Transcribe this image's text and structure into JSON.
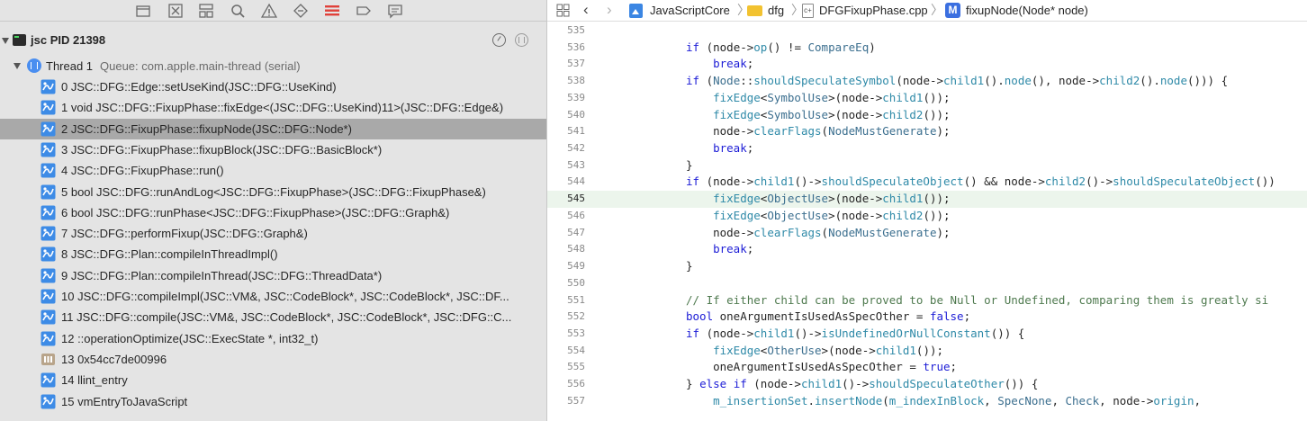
{
  "navigator": {
    "process": {
      "name": "jsc",
      "pid": "PID 21398"
    },
    "thread": {
      "name": "Thread 1",
      "queue": "Queue: com.apple.main-thread (serial)"
    },
    "frames": [
      {
        "label": "0 JSC::DFG::Edge::setUseKind(JSC::DFG::UseKind)",
        "icon": "user-frame-icon",
        "selected": false
      },
      {
        "label": "1 void JSC::DFG::FixupPhase::fixEdge<(JSC::DFG::UseKind)11>(JSC::DFG::Edge&)",
        "icon": "user-frame-icon",
        "selected": false
      },
      {
        "label": "2 JSC::DFG::FixupPhase::fixupNode(JSC::DFG::Node*)",
        "icon": "user-frame-icon",
        "selected": true
      },
      {
        "label": "3 JSC::DFG::FixupPhase::fixupBlock(JSC::DFG::BasicBlock*)",
        "icon": "user-frame-icon",
        "selected": false
      },
      {
        "label": "4 JSC::DFG::FixupPhase::run()",
        "icon": "user-frame-icon",
        "selected": false
      },
      {
        "label": "5 bool JSC::DFG::runAndLog<JSC::DFG::FixupPhase>(JSC::DFG::FixupPhase&)",
        "icon": "user-frame-icon",
        "selected": false
      },
      {
        "label": "6 bool JSC::DFG::runPhase<JSC::DFG::FixupPhase>(JSC::DFG::Graph&)",
        "icon": "user-frame-icon",
        "selected": false
      },
      {
        "label": "7 JSC::DFG::performFixup(JSC::DFG::Graph&)",
        "icon": "user-frame-icon",
        "selected": false
      },
      {
        "label": "8 JSC::DFG::Plan::compileInThreadImpl()",
        "icon": "user-frame-icon",
        "selected": false
      },
      {
        "label": "9 JSC::DFG::Plan::compileInThread(JSC::DFG::ThreadData*)",
        "icon": "user-frame-icon",
        "selected": false
      },
      {
        "label": "10 JSC::DFG::compileImpl(JSC::VM&, JSC::CodeBlock*, JSC::CodeBlock*, JSC::DF...",
        "icon": "user-frame-icon",
        "selected": false
      },
      {
        "label": "11 JSC::DFG::compile(JSC::VM&, JSC::CodeBlock*, JSC::CodeBlock*, JSC::DFG::C...",
        "icon": "user-frame-icon",
        "selected": false
      },
      {
        "label": "12 ::operationOptimize(JSC::ExecState *, int32_t)",
        "icon": "user-frame-icon",
        "selected": false
      },
      {
        "label": "13 0x54cc7de00996",
        "icon": "unknown-frame-icon",
        "selected": false
      },
      {
        "label": "14 llint_entry",
        "icon": "user-frame-icon",
        "selected": false
      },
      {
        "label": "15 vmEntryToJavaScript",
        "icon": "user-frame-icon",
        "selected": false
      }
    ]
  },
  "jumpbar": {
    "project": "JavaScriptCore",
    "folder": "dfg",
    "file": "DFGFixupPhase.cpp",
    "method_badge": "M",
    "symbol": "fixupNode(Node* node)"
  },
  "editor": {
    "current_line": "545",
    "lines": [
      {
        "n": "535",
        "html": ""
      },
      {
        "n": "536",
        "html": "<span class=\"kw\">if</span> (node-><span class=\"fn\">op</span>() != <span class=\"ty\">CompareEq</span>)"
      },
      {
        "n": "537",
        "html": "    <span class=\"kw\">break</span>;"
      },
      {
        "n": "538",
        "html": "<span class=\"kw\">if</span> (<span class=\"ty\">Node</span>::<span class=\"fn\">shouldSpeculateSymbol</span>(node-><span class=\"fn\">child1</span>().<span class=\"fn\">node</span>(), node-><span class=\"fn\">child2</span>().<span class=\"fn\">node</span>())) {"
      },
      {
        "n": "539",
        "html": "    <span class=\"fn\">fixEdge</span><<span class=\"ty\">SymbolUse</span>>(node-><span class=\"fn\">child1</span>());"
      },
      {
        "n": "540",
        "html": "    <span class=\"fn\">fixEdge</span><<span class=\"ty\">SymbolUse</span>>(node-><span class=\"fn\">child2</span>());"
      },
      {
        "n": "541",
        "html": "    node-><span class=\"fn\">clearFlags</span>(<span class=\"ty\">NodeMustGenerate</span>);"
      },
      {
        "n": "542",
        "html": "    <span class=\"kw\">break</span>;"
      },
      {
        "n": "543",
        "html": "}"
      },
      {
        "n": "544",
        "html": "<span class=\"kw\">if</span> (node-><span class=\"fn\">child1</span>()-><span class=\"fn\">shouldSpeculateObject</span>() && node-><span class=\"fn\">child2</span>()-><span class=\"fn\">shouldSpeculateObject</span>())"
      },
      {
        "n": "545",
        "html": "    <span class=\"fn\">fixEdge</span><<span class=\"ty\">ObjectUse</span>>(node-><span class=\"fn\">child1</span>());"
      },
      {
        "n": "546",
        "html": "    <span class=\"fn\">fixEdge</span><<span class=\"ty\">ObjectUse</span>>(node-><span class=\"fn\">child2</span>());"
      },
      {
        "n": "547",
        "html": "    node-><span class=\"fn\">clearFlags</span>(<span class=\"ty\">NodeMustGenerate</span>);"
      },
      {
        "n": "548",
        "html": "    <span class=\"kw\">break</span>;"
      },
      {
        "n": "549",
        "html": "}"
      },
      {
        "n": "550",
        "html": ""
      },
      {
        "n": "551",
        "html": "<span class=\"cm\">// If either child can be proved to be Null or Undefined, comparing them is greatly si</span>"
      },
      {
        "n": "552",
        "html": "<span class=\"kw\">bool</span> oneArgumentIsUsedAsSpecOther = <span class=\"bool\">false</span>;"
      },
      {
        "n": "553",
        "html": "<span class=\"kw\">if</span> (node-><span class=\"fn\">child1</span>()-><span class=\"fn\">isUndefinedOrNullConstant</span>()) {"
      },
      {
        "n": "554",
        "html": "    <span class=\"fn\">fixEdge</span><<span class=\"ty\">OtherUse</span>>(node-><span class=\"fn\">child1</span>());"
      },
      {
        "n": "555",
        "html": "    oneArgumentIsUsedAsSpecOther = <span class=\"bool\">true</span>;"
      },
      {
        "n": "556",
        "html": "} <span class=\"kw\">else if</span> (node-><span class=\"fn\">child1</span>()-><span class=\"fn\">shouldSpeculateOther</span>()) {"
      },
      {
        "n": "557",
        "html": "    <span class=\"fn\">m_insertionSet</span>.<span class=\"fn\">insertNode</span>(<span class=\"fn\">m_indexInBlock</span>, <span class=\"ty\">SpecNone</span>, <span class=\"ty\">Check</span>, node-><span class=\"fn\">origin</span>,"
      }
    ]
  }
}
